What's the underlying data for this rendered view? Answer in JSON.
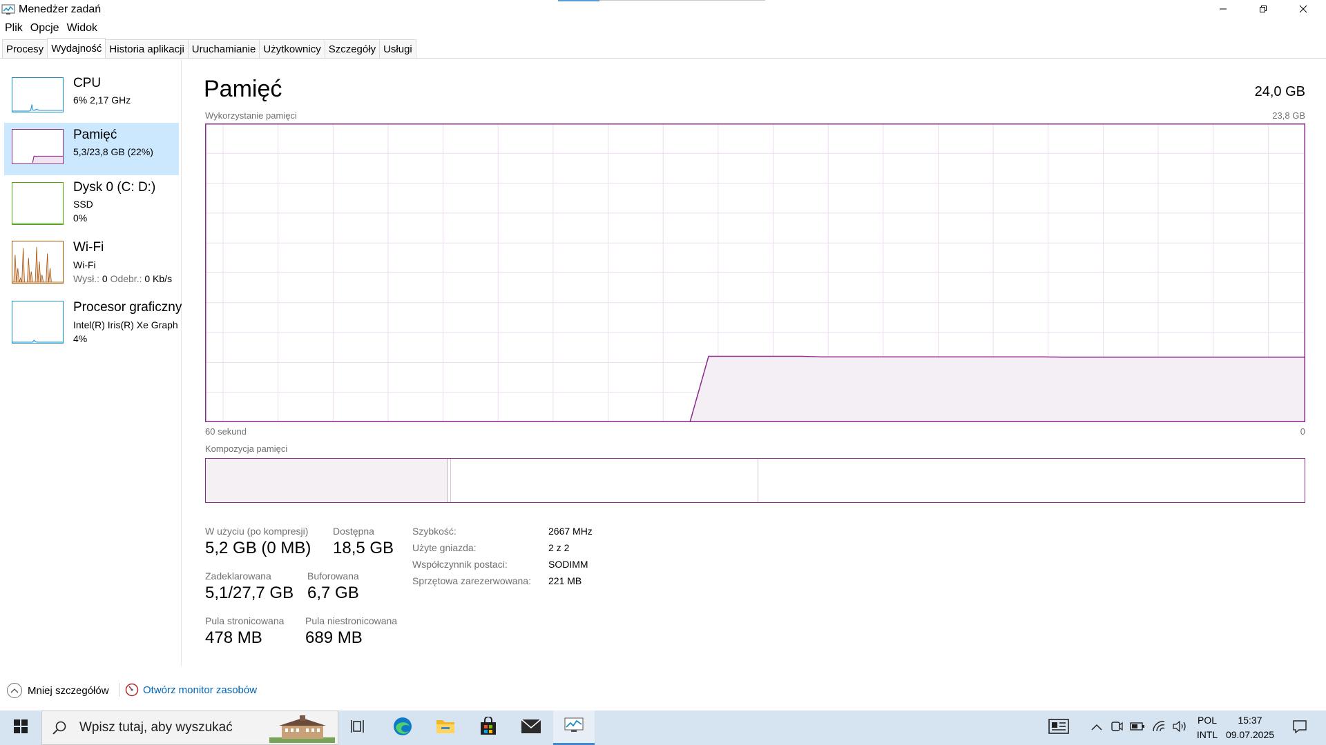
{
  "window": {
    "title": "Menedżer zadań",
    "icons": {
      "app": "task-manager-icon",
      "minimize": "minimize-icon",
      "maximize": "restore-icon",
      "close": "close-icon"
    }
  },
  "menu": [
    "Plik",
    "Opcje",
    "Widok"
  ],
  "tabs": [
    "Procesy",
    "Wydajność",
    "Historia aplikacji",
    "Uruchamianie",
    "Użytkownicy",
    "Szczegóły",
    "Usługi"
  ],
  "active_tab": "Wydajność",
  "sidebar": {
    "items": [
      {
        "name": "CPU",
        "line1": "6% 2,17 GHz",
        "color": "#1a8fc4"
      },
      {
        "name": "Pamięć",
        "line1": "5,3/23,8 GB (22%)",
        "color": "#8b2a8b",
        "selected": true
      },
      {
        "name": "Dysk 0 (C: D:)",
        "line1": "SSD",
        "line2": "0%",
        "color": "#4da60c"
      },
      {
        "name": "Wi-Fi",
        "line1": "Wi-Fi",
        "send_label": "Wysł.:",
        "send_val": "0",
        "recv_label": "Odebr.:",
        "recv_val": "0 Kb/s",
        "color": "#a74f01"
      },
      {
        "name": "Procesor graficzny",
        "line1": "Intel(R) Iris(R) Xe Graph",
        "line2": "4%",
        "color": "#1a8fc4"
      }
    ]
  },
  "main": {
    "title": "Pamięć",
    "total": "24,0 GB",
    "usage_label": "Wykorzystanie pamięci",
    "usage_max": "23,8 GB",
    "axis_left": "60 sekund",
    "axis_right": "0",
    "composition_label": "Kompozycja pamięci",
    "color": "#8b2a8b"
  },
  "chart_data": {
    "type": "area",
    "x_range_seconds": [
      60,
      0
    ],
    "ylim": [
      0,
      23.8
    ],
    "values": [
      null,
      null,
      null,
      null,
      null,
      null,
      null,
      null,
      null,
      null,
      null,
      null,
      null,
      null,
      null,
      null,
      null,
      null,
      null,
      null,
      null,
      null,
      null,
      null,
      null,
      null,
      0,
      5.25,
      5.25,
      5.25,
      5.25,
      5.25,
      5.25,
      5.2,
      5.2,
      5.2,
      5.2,
      5.2,
      5.2,
      5.2,
      5.2,
      5.2,
      5.2,
      5.2,
      5.2,
      5.2,
      5.18,
      5.18,
      5.18,
      5.18,
      5.18,
      5.18,
      5.18,
      5.18,
      5.18,
      5.18,
      5.18,
      5.18,
      5.18,
      5.18
    ],
    "grid": true
  },
  "composition": {
    "in_use_fraction": 0.22,
    "modified_fraction": 0.003,
    "standby_fraction": 0.28
  },
  "stats": {
    "in_use": {
      "label": "W użyciu (po kompresji)",
      "value": "5,2 GB (0 MB)"
    },
    "available": {
      "label": "Dostępna",
      "value": "18,5 GB"
    },
    "committed": {
      "label": "Zadeklarowana",
      "value": "5,1/27,7 GB"
    },
    "cached": {
      "label": "Buforowana",
      "value": "6,7 GB"
    },
    "paged_pool": {
      "label": "Pula stronicowana",
      "value": "478 MB"
    },
    "nonpaged_pool": {
      "label": "Pula niestronicowana",
      "value": "689 MB"
    }
  },
  "details": [
    {
      "key": "Szybkość:",
      "value": "2667 MHz"
    },
    {
      "key": "Użyte gniazda:",
      "value": "2 z 2"
    },
    {
      "key": "Współczynnik postaci:",
      "value": "SODIMM"
    },
    {
      "key": "Sprzętowa zarezerwowana:",
      "value": "221 MB"
    }
  ],
  "footer": {
    "less_details": "Mniej szczegółów",
    "resource_monitor": "Otwórz monitor zasobów"
  },
  "taskbar": {
    "search_placeholder": "Wpisz tutaj, aby wyszukać",
    "icons": [
      "windows-start-icon",
      "search-icon",
      "task-view-icon",
      "edge-icon",
      "file-explorer-icon",
      "store-icon",
      "mail-icon",
      "task-manager-icon"
    ],
    "tray_icons": [
      "news-icon",
      "chevron-up-icon",
      "meet-now-icon",
      "battery-icon",
      "wifi-icon",
      "volume-icon",
      "notifications-icon"
    ],
    "lang_line1": "POL",
    "lang_line2": "INTL",
    "time": "15:37",
    "date": "09.07.2025"
  }
}
